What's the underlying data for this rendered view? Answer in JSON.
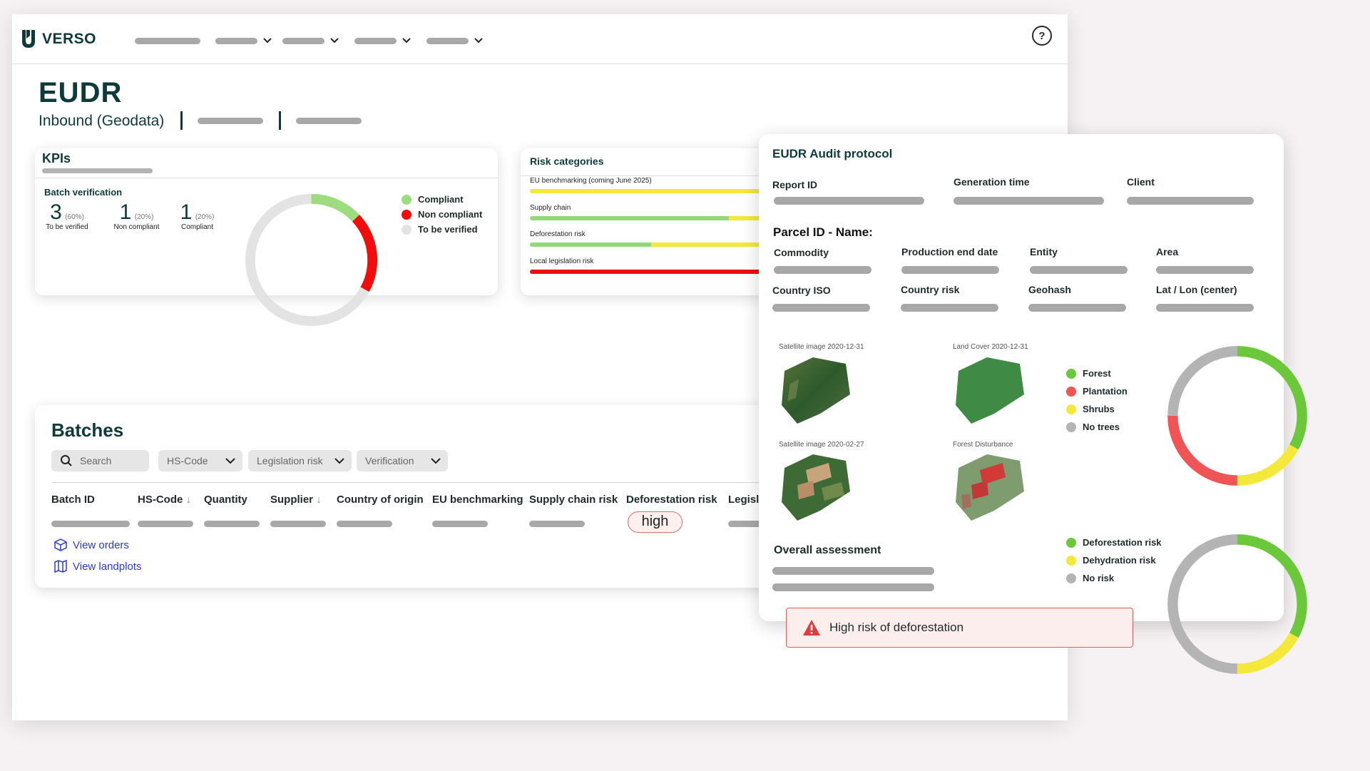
{
  "brand": {
    "name": "VERSO"
  },
  "help": {
    "label": "?"
  },
  "page": {
    "title": "EUDR",
    "subtitle": "Inbound (Geodata)"
  },
  "kpis": {
    "title": "KPIs",
    "batch_verification": "Batch verification",
    "stats": [
      {
        "number": "3",
        "percent": "(60%)",
        "caption": "To be verified"
      },
      {
        "number": "1",
        "percent": "(20%)",
        "caption": "Non compliant"
      },
      {
        "number": "1",
        "percent": "(20%)",
        "caption": "Compliant"
      }
    ],
    "legend": [
      {
        "label": "Compliant",
        "color": "#9ddc7f"
      },
      {
        "label": "Non compliant",
        "color": "#f20d0d"
      },
      {
        "label": "To be verified",
        "color": "#e3e3e3"
      }
    ],
    "donut": {
      "compliant": 0.13,
      "non_compliant": 0.2,
      "to_be_verified": 0.67
    }
  },
  "risk_categories": {
    "title": "Risk categories",
    "rows": [
      {
        "label": "EU benchmarking (coming June 2025)",
        "segments": [
          {
            "value": 1,
            "color": "#f4e93a"
          }
        ]
      },
      {
        "label": "Supply chain",
        "segments": [
          {
            "value": 0.82,
            "color": "#93d879"
          },
          {
            "value": 0.18,
            "color": "#f4e93a"
          }
        ]
      },
      {
        "label": "Deforestation risk",
        "segments": [
          {
            "value": 0.5,
            "color": "#93d879"
          },
          {
            "value": 0.5,
            "color": "#f4e93a"
          }
        ]
      },
      {
        "label": "Local legislation risk",
        "segments": [
          {
            "value": 1,
            "color": "#f20d0d"
          }
        ]
      }
    ]
  },
  "batches": {
    "title": "Batches",
    "search_placeholder": "Search",
    "filters": [
      "HS-Code",
      "Legislation risk",
      "Verification"
    ],
    "columns": [
      "Batch ID",
      "HS-Code",
      "Quantity",
      "Supplier",
      "Country of origin",
      "EU benchmarking",
      "Supply chain risk",
      "Deforestation risk",
      "Legisl"
    ],
    "row": {
      "deforestation_risk": "high"
    },
    "links": {
      "view_orders": "View orders",
      "view_landplots": "View landplots"
    }
  },
  "audit": {
    "title": "EUDR Audit protocol",
    "meta_labels": [
      "Report ID",
      "Generation time",
      "Client"
    ],
    "parcel_title": "Parcel ID - Name:",
    "parcel_labels": [
      "Commodity",
      "Production end date",
      "Entity",
      "Area",
      "Country ISO",
      "Country risk",
      "Geohash",
      "Lat / Lon (center)"
    ],
    "images": [
      {
        "caption": "Satellite image 2020-12-31"
      },
      {
        "caption": "Land Cover 2020-12-31"
      },
      {
        "caption": "Satellite image 2020-02-27"
      },
      {
        "caption": "Forest Disturbance"
      }
    ],
    "landcover_legend": [
      {
        "label": "Forest",
        "color": "#6cc83b"
      },
      {
        "label": "Plantation",
        "color": "#f05454"
      },
      {
        "label": "Shrubs",
        "color": "#f4e93a"
      },
      {
        "label": "No trees",
        "color": "#b4b4b4"
      }
    ],
    "landcover_donut": {
      "forest": 0.33,
      "shrubs": 0.17,
      "plantation": 0.25,
      "no_trees": 0.25
    },
    "overall_label": "Overall assessment",
    "risk_legend": [
      {
        "label": "Deforestation risk",
        "color": "#6cc83b"
      },
      {
        "label": "Dehydration risk",
        "color": "#f4e93a"
      },
      {
        "label": "No risk",
        "color": "#b4b4b4"
      }
    ],
    "risk_donut": {
      "deforestation": 0.33,
      "dehydration": 0.17,
      "no_risk": 0.5
    },
    "alert": "High risk of deforestation"
  }
}
